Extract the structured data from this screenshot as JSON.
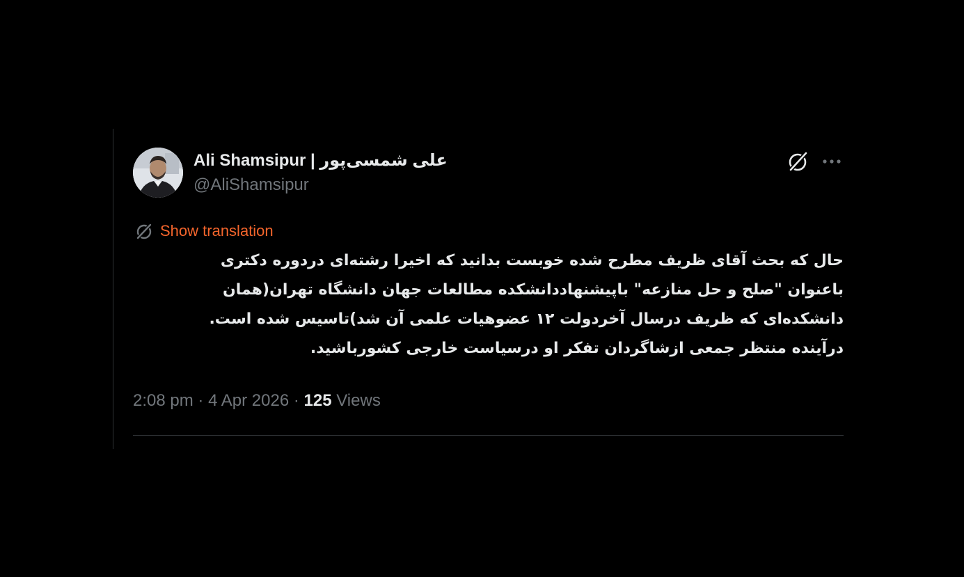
{
  "tweet": {
    "author": {
      "display_name": "Ali Shamsipur | علی شمسی‌پور",
      "handle": "@AliShamsipur",
      "avatar_icon": "avatar"
    },
    "header_icons": {
      "grok": "grok-icon",
      "more": "more-icon"
    },
    "translation": {
      "label": "Show translation",
      "icon": "translate-icon",
      "color": "#f4652c"
    },
    "body_lines": [
      "حال که بحث آقای ظریف مطرح شده خوبست بدانید که اخیرا رشته‌ای دردوره دکتری",
      "باعنوان \"صلح و حل منازعه\" باپیشنهاددانشکده مطالعات جهان دانشگاه تهران(همان",
      "دانشکده‌ای که ظریف درسال آخردولت ۱۲ عضوهیات علمی آن شد)تاسیس شده است.",
      "درآینده منتظر جمعی ازشاگردان تفکر او درسیاست خارجی کشورباشید."
    ],
    "meta": {
      "time": "2:08 pm",
      "separator": "·",
      "date": "4 Apr 2026",
      "views_count": "125",
      "views_label": "Views"
    }
  },
  "colors": {
    "background": "#000000",
    "text_primary": "#e7e9ea",
    "text_secondary": "#71767b",
    "divider": "#2f3336",
    "accent": "#f4652c"
  }
}
